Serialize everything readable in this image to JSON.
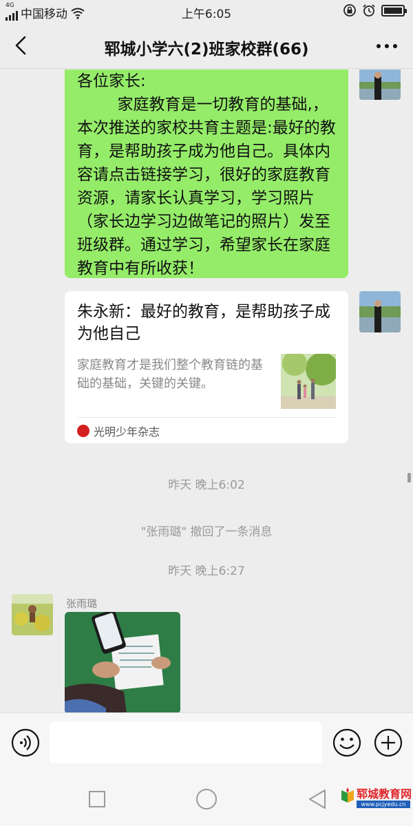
{
  "status_bar": {
    "network_tag": "4G",
    "carrier": "中国移动",
    "time": "上午6:05",
    "icons": [
      "signal-icon",
      "wifi-icon",
      "lock-rotation-icon",
      "alarm-icon",
      "battery-icon"
    ]
  },
  "header": {
    "title": "郓城小学六(2)班家校群(66)",
    "back_icon": "chevron-left-icon",
    "more_icon": "more-dots-icon"
  },
  "messages": {
    "text_message": "各位家长:\n        家庭教育是一切教育的基础,，本次推送的家校共育主题是:最好的教育，是帮助孩子成为他自己。具体内容请点击链接学习，很好的家庭教育资源，请家长认真学习，学习照片（家长边学习边做笔记的照片）发至班级群。通过学习，希望家长在家庭教育中有所收获！",
    "link_card": {
      "title": "朱永新：最好的教育，是帮助孩子成为他自己",
      "description": "家庭教育才是我们整个教育链的基础的基础，关键的关键。",
      "source": "光明少年杂志"
    },
    "time_1": "昨天 晚上6:02",
    "recall_notice": "\"张雨璐\" 撤回了一条消息",
    "time_2": "昨天 晚上6:27",
    "sender_name": "张雨璐"
  },
  "input_bar": {
    "value": "",
    "icons": [
      "voice-icon",
      "emoji-icon",
      "plus-icon"
    ]
  },
  "nav_bar": {
    "icons": [
      "recent-apps-icon",
      "home-icon",
      "back-icon"
    ]
  },
  "watermark": {
    "title": "郓城教育网",
    "url": "www.pcjyedu.cn"
  },
  "colors": {
    "chat_background": "#ededed",
    "outgoing_bubble": "#95ec69",
    "card_background": "#ffffff",
    "system_text": "#9a9a9a"
  }
}
